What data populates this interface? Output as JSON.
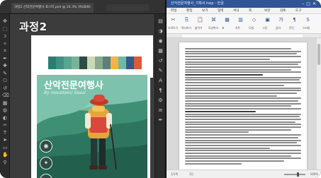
{
  "overlay": {
    "lesson_label": "과정2"
  },
  "photoshop": {
    "tab_title": "과정2 산악전문여행사 포스터.psd @ 33.3% (RGB/8)",
    "poster": {
      "title": "산악전문여행사",
      "subtitle": "By mountain/ Seoul"
    },
    "swatch_colors": [
      "#2b7d72",
      "#42907f",
      "#5aa58f",
      "#79b29a",
      "#2f4b45",
      "#c9d9b5",
      "#8aa88c",
      "#5c7f7a",
      "#f2b447",
      "#6fb9a6",
      "#345a8a",
      "#d85c3a"
    ],
    "toolbar_icons": [
      "move-icon",
      "marquee-icon",
      "lasso-icon",
      "magic-wand-icon",
      "crop-icon",
      "eyedropper-icon",
      "healing-icon",
      "brush-icon",
      "stamp-icon",
      "history-brush-icon",
      "eraser-icon",
      "gradient-icon",
      "blur-icon",
      "dodge-icon",
      "pen-icon",
      "type-icon",
      "path-select-icon",
      "shape-icon",
      "hand-icon",
      "zoom-icon"
    ],
    "panel_icons": [
      "layers-icon",
      "adjust-icon",
      "color-icon",
      "swatches-icon",
      "history-icon",
      "brush-panel-icon",
      "character-icon",
      "paragraph-icon",
      "properties-icon",
      "channels-icon",
      "paths-icon"
    ]
  },
  "word": {
    "title": "산악전문여행사_기획서.hwp - 한글",
    "menus": [
      "파일",
      "편집",
      "보기",
      "입력",
      "서식",
      "쪽",
      "보안",
      "검토",
      "도구"
    ],
    "ribbon": [
      {
        "icon": "cut-icon",
        "label": "오려두기"
      },
      {
        "icon": "copy-icon",
        "label": "복사하기"
      },
      {
        "icon": "paste-icon",
        "label": "붙이기"
      },
      {
        "icon": "format-icon",
        "label": "모양복사"
      },
      {
        "icon": "table-icon",
        "label": "표"
      },
      {
        "icon": "chart-icon",
        "label": "차트"
      },
      {
        "icon": "shape-icon",
        "label": "도형"
      },
      {
        "icon": "image-icon",
        "label": "그림"
      },
      {
        "icon": "char-icon",
        "label": "글자"
      },
      {
        "icon": "para-icon",
        "label": "문단"
      },
      {
        "icon": "style-icon",
        "label": "스타일"
      }
    ],
    "status": {
      "page": "1/1쪽",
      "section": "1단",
      "zoom": "100%"
    }
  }
}
